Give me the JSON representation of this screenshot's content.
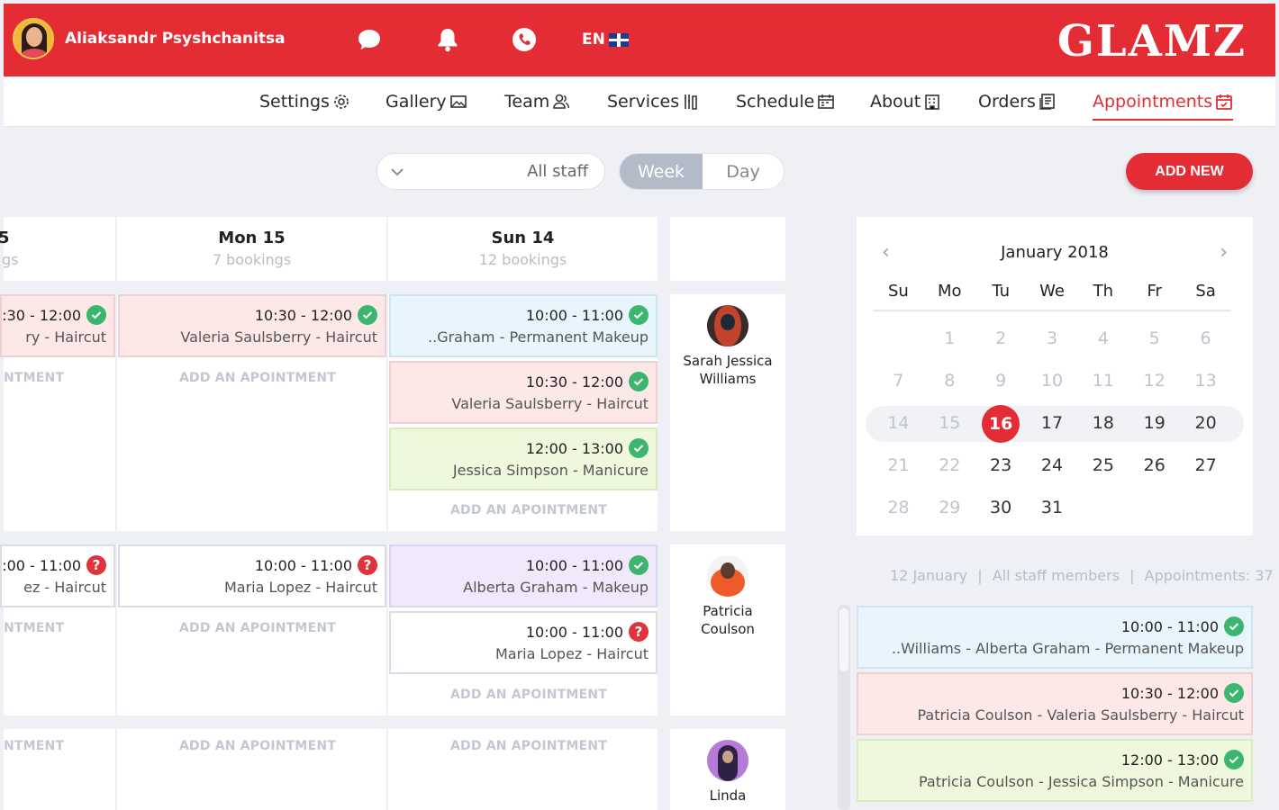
{
  "header": {
    "user_name": "Aliaksandr Psyshchanitsa",
    "language": "EN",
    "logo": "GLAMZ",
    "icons": [
      "chat-icon",
      "bell-icon",
      "phone-icon"
    ]
  },
  "nav": [
    {
      "label": "Settings",
      "icon": "gear-icon"
    },
    {
      "label": "Gallery",
      "icon": "image-icon"
    },
    {
      "label": "Team",
      "icon": "team-icon"
    },
    {
      "label": "Services",
      "icon": "tools-icon"
    },
    {
      "label": "Schedule",
      "icon": "schedule-icon"
    },
    {
      "label": "About",
      "icon": "building-icon"
    },
    {
      "label": "Orders",
      "icon": "orders-icon"
    },
    {
      "label": "Appointments",
      "icon": "calendar-icon",
      "active": true
    }
  ],
  "toolbar": {
    "staff_filter": "All staff",
    "view_week": "Week",
    "view_day": "Day",
    "selected_view": "Week",
    "add_new": "ADD NEW"
  },
  "columns": [
    {
      "day": "5",
      "count": "gs"
    },
    {
      "day": "Mon 15",
      "count": "7 bookings"
    },
    {
      "day": "Sun 14",
      "count": "12 bookings"
    }
  ],
  "add_label": "ADD AN APOINTMENT",
  "add_label_cut": "NTMENT",
  "appointments": {
    "c0r0": {
      "time": "):30 - 12:00",
      "desc": "ry - Haircut",
      "status": "ok"
    },
    "c0r1": {
      "time": "):00 - 11:00",
      "desc": "ez - Haircut",
      "status": "pending"
    },
    "c1r0": {
      "time": "10:30 - 12:00",
      "desc": "Valeria Saulsberry - Haircut",
      "status": "ok"
    },
    "c1r1": {
      "time": "10:00 - 11:00",
      "desc": "Maria Lopez - Haircut",
      "status": "pending"
    },
    "c2r0a": {
      "time": "10:00 - 11:00",
      "desc": "..Graham - Permanent Makeup",
      "status": "ok"
    },
    "c2r0b": {
      "time": "10:30 - 12:00",
      "desc": "Valeria Saulsberry - Haircut",
      "status": "ok"
    },
    "c2r0c": {
      "time": "12:00 - 13:00",
      "desc": "Jessica Simpson - Manicure",
      "status": "ok"
    },
    "c2r1a": {
      "time": "10:00 - 11:00",
      "desc": "Alberta Graham - Makeup",
      "status": "ok"
    },
    "c2r1b": {
      "time": "10:00 - 11:00",
      "desc": "Maria Lopez - Haircut",
      "status": "pending"
    }
  },
  "staff": [
    {
      "name": "Sarah Jessica Williams",
      "line1": "Sarah Jessica",
      "line2": "Williams"
    },
    {
      "name": "Patricia Coulson",
      "line1": "Patricia",
      "line2": "Coulson"
    },
    {
      "name": "Linda",
      "line1": "Linda",
      "line2": ""
    }
  ],
  "calendar": {
    "title": "January 2018",
    "weekdays": [
      "Su",
      "Mo",
      "Tu",
      "We",
      "Th",
      "Fr",
      "Sa"
    ],
    "weeks": [
      [
        "",
        "1",
        "2",
        "3",
        "4",
        "5",
        "6"
      ],
      [
        "7",
        "8",
        "9",
        "10",
        "11",
        "12",
        "13"
      ],
      [
        "14",
        "15",
        "16",
        "17",
        "18",
        "19",
        "20"
      ],
      [
        "21",
        "22",
        "23",
        "24",
        "25",
        "26",
        "27"
      ],
      [
        "28",
        "29",
        "30",
        "31",
        "",
        "",
        ""
      ]
    ],
    "today": "16"
  },
  "summary": {
    "date": "12 January",
    "staff": "All staff members",
    "appointments": "Appointments: 37",
    "separator": "|"
  },
  "side_list": [
    {
      "time": "10:00 - 11:00",
      "desc": "..Williams - Alberta Graham - Permanent Makeup",
      "status": "ok"
    },
    {
      "time": "10:30 - 12:00",
      "desc": "Patricia Coulson - Valeria Saulsberry - Haircut",
      "status": "ok"
    },
    {
      "time": "12:00 - 13:00",
      "desc": "Patricia Coulson - Jessica Simpson - Manicure",
      "status": "ok"
    }
  ],
  "colors": {
    "brand": "#e42c35",
    "ok": "#3cb66e",
    "pending": "#e0333b"
  }
}
